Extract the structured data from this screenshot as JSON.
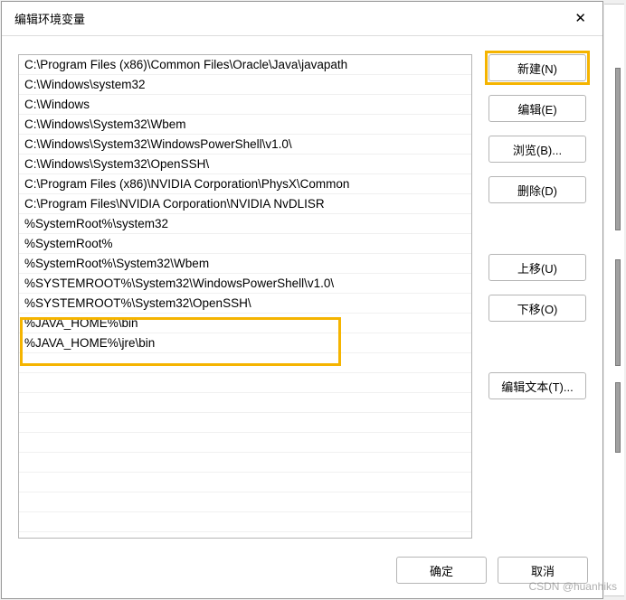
{
  "dialog": {
    "title": "编辑环境变量"
  },
  "list": {
    "items": [
      "C:\\Program Files (x86)\\Common Files\\Oracle\\Java\\javapath",
      "C:\\Windows\\system32",
      "C:\\Windows",
      "C:\\Windows\\System32\\Wbem",
      "C:\\Windows\\System32\\WindowsPowerShell\\v1.0\\",
      "C:\\Windows\\System32\\OpenSSH\\",
      "C:\\Program Files (x86)\\NVIDIA Corporation\\PhysX\\Common",
      "C:\\Program Files\\NVIDIA Corporation\\NVIDIA NvDLISR",
      "%SystemRoot%\\system32",
      "%SystemRoot%",
      "%SystemRoot%\\System32\\Wbem",
      "%SYSTEMROOT%\\System32\\WindowsPowerShell\\v1.0\\",
      "%SYSTEMROOT%\\System32\\OpenSSH\\",
      "%JAVA_HOME%\\bin",
      "%JAVA_HOME%\\jre\\bin"
    ]
  },
  "buttons": {
    "new": "新建(N)",
    "edit": "编辑(E)",
    "browse": "浏览(B)...",
    "delete": "删除(D)",
    "moveup": "上移(U)",
    "movedown": "下移(O)",
    "edittext": "编辑文本(T)...",
    "ok": "确定",
    "cancel": "取消"
  },
  "watermark": "CSDN @huanhiks"
}
